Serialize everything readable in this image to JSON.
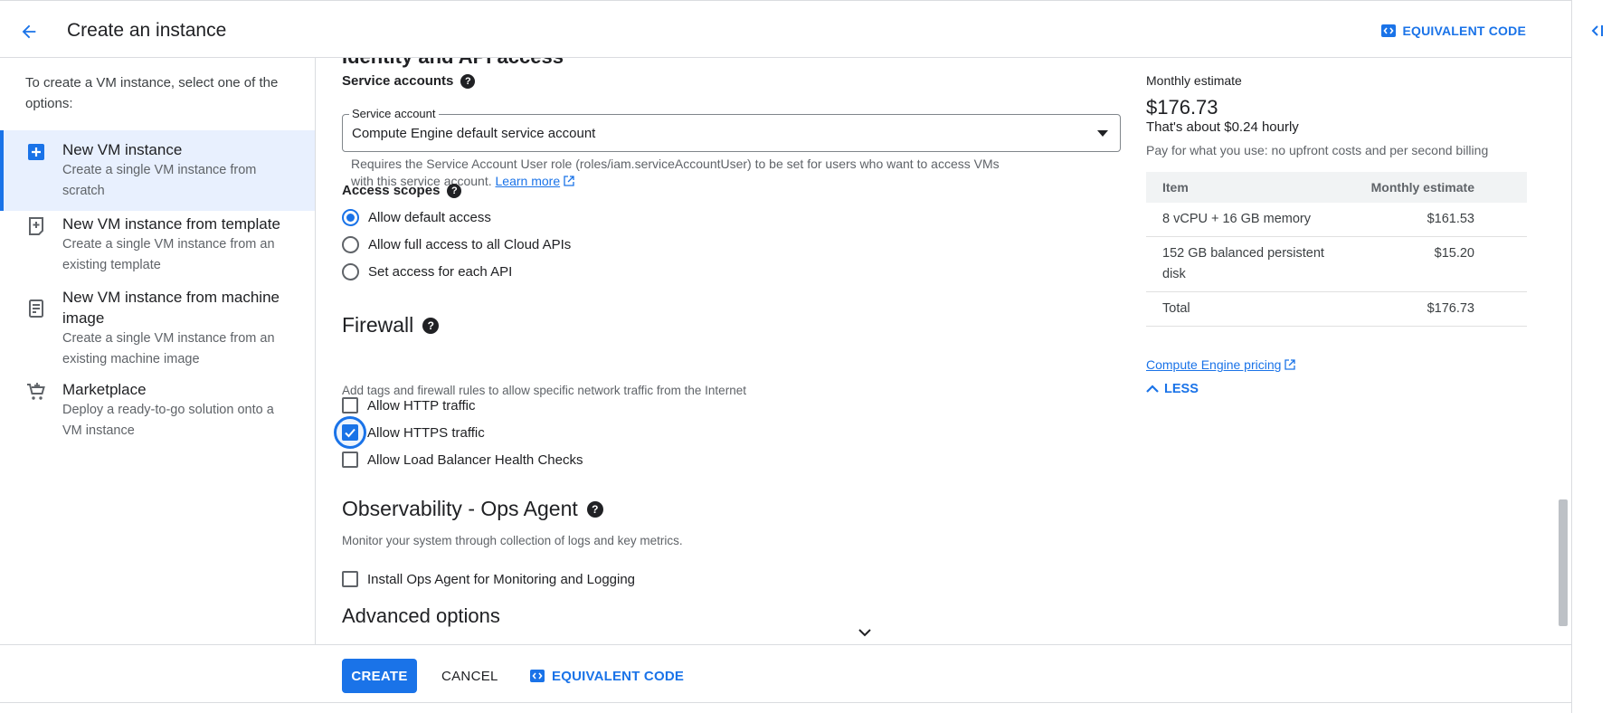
{
  "header": {
    "title": "Create an instance",
    "equivalent_code_label": "EQUIVALENT CODE"
  },
  "sidebar": {
    "intro": "To create a VM instance, select one of the options:",
    "options": [
      {
        "title": "New VM instance",
        "description": "Create a single VM instance from scratch",
        "icon": "add-box-icon"
      },
      {
        "title": "New VM instance from template",
        "description": "Create a single VM instance from an existing template",
        "icon": "template-icon"
      },
      {
        "title": "New VM instance from machine image",
        "description": "Create a single VM instance from an existing machine image",
        "icon": "machine-image-icon"
      },
      {
        "title": "Marketplace",
        "description": "Deploy a ready-to-go solution onto a VM instance",
        "icon": "cart-icon"
      }
    ]
  },
  "identity": {
    "section_title": "Identity and API access",
    "service_accounts_label": "Service accounts",
    "service_account_legend": "Service account",
    "service_account_value": "Compute Engine default service account",
    "requirement_text": "Requires the Service Account User role (roles/iam.serviceAccountUser) to be set for users who want to access VMs with this service account.",
    "learn_more": "Learn more",
    "access_scopes_label": "Access scopes",
    "scopes": [
      {
        "label": "Allow default access",
        "selected": true
      },
      {
        "label": "Allow full access to all Cloud APIs",
        "selected": false
      },
      {
        "label": "Set access for each API",
        "selected": false
      }
    ]
  },
  "firewall": {
    "title": "Firewall",
    "description": "Add tags and firewall rules to allow specific network traffic from the Internet",
    "options": [
      {
        "label": "Allow HTTP traffic",
        "checked": false
      },
      {
        "label": "Allow HTTPS traffic",
        "checked": true
      },
      {
        "label": "Allow Load Balancer Health Checks",
        "checked": false
      }
    ]
  },
  "observability": {
    "title": "Observability - Ops Agent",
    "description": "Monitor your system through collection of logs and key metrics.",
    "option_label": "Install Ops Agent for Monitoring and Logging",
    "option_checked": false
  },
  "advanced": {
    "title": "Advanced options"
  },
  "estimate": {
    "title": "Monthly estimate",
    "price": "$176.73",
    "hourly": "That's about $0.24 hourly",
    "note": "Pay for what you use: no upfront costs and per second billing",
    "col_item": "Item",
    "col_estimate": "Monthly estimate",
    "rows": [
      {
        "item": "8 vCPU + 16 GB memory",
        "value": "$161.53"
      },
      {
        "item": "152 GB balanced persistent disk",
        "value": "$15.20"
      },
      {
        "item": "Total",
        "value": "$176.73"
      }
    ],
    "pricing_link": "Compute Engine pricing",
    "less_label": "LESS"
  },
  "footer": {
    "create_label": "CREATE",
    "cancel_label": "CANCEL",
    "equivalent_code_label": "EQUIVALENT CODE"
  },
  "colors": {
    "accent": "#1a73e8",
    "selected_bg": "#e8f0fe",
    "text": "#202124",
    "muted": "#5f6368"
  }
}
